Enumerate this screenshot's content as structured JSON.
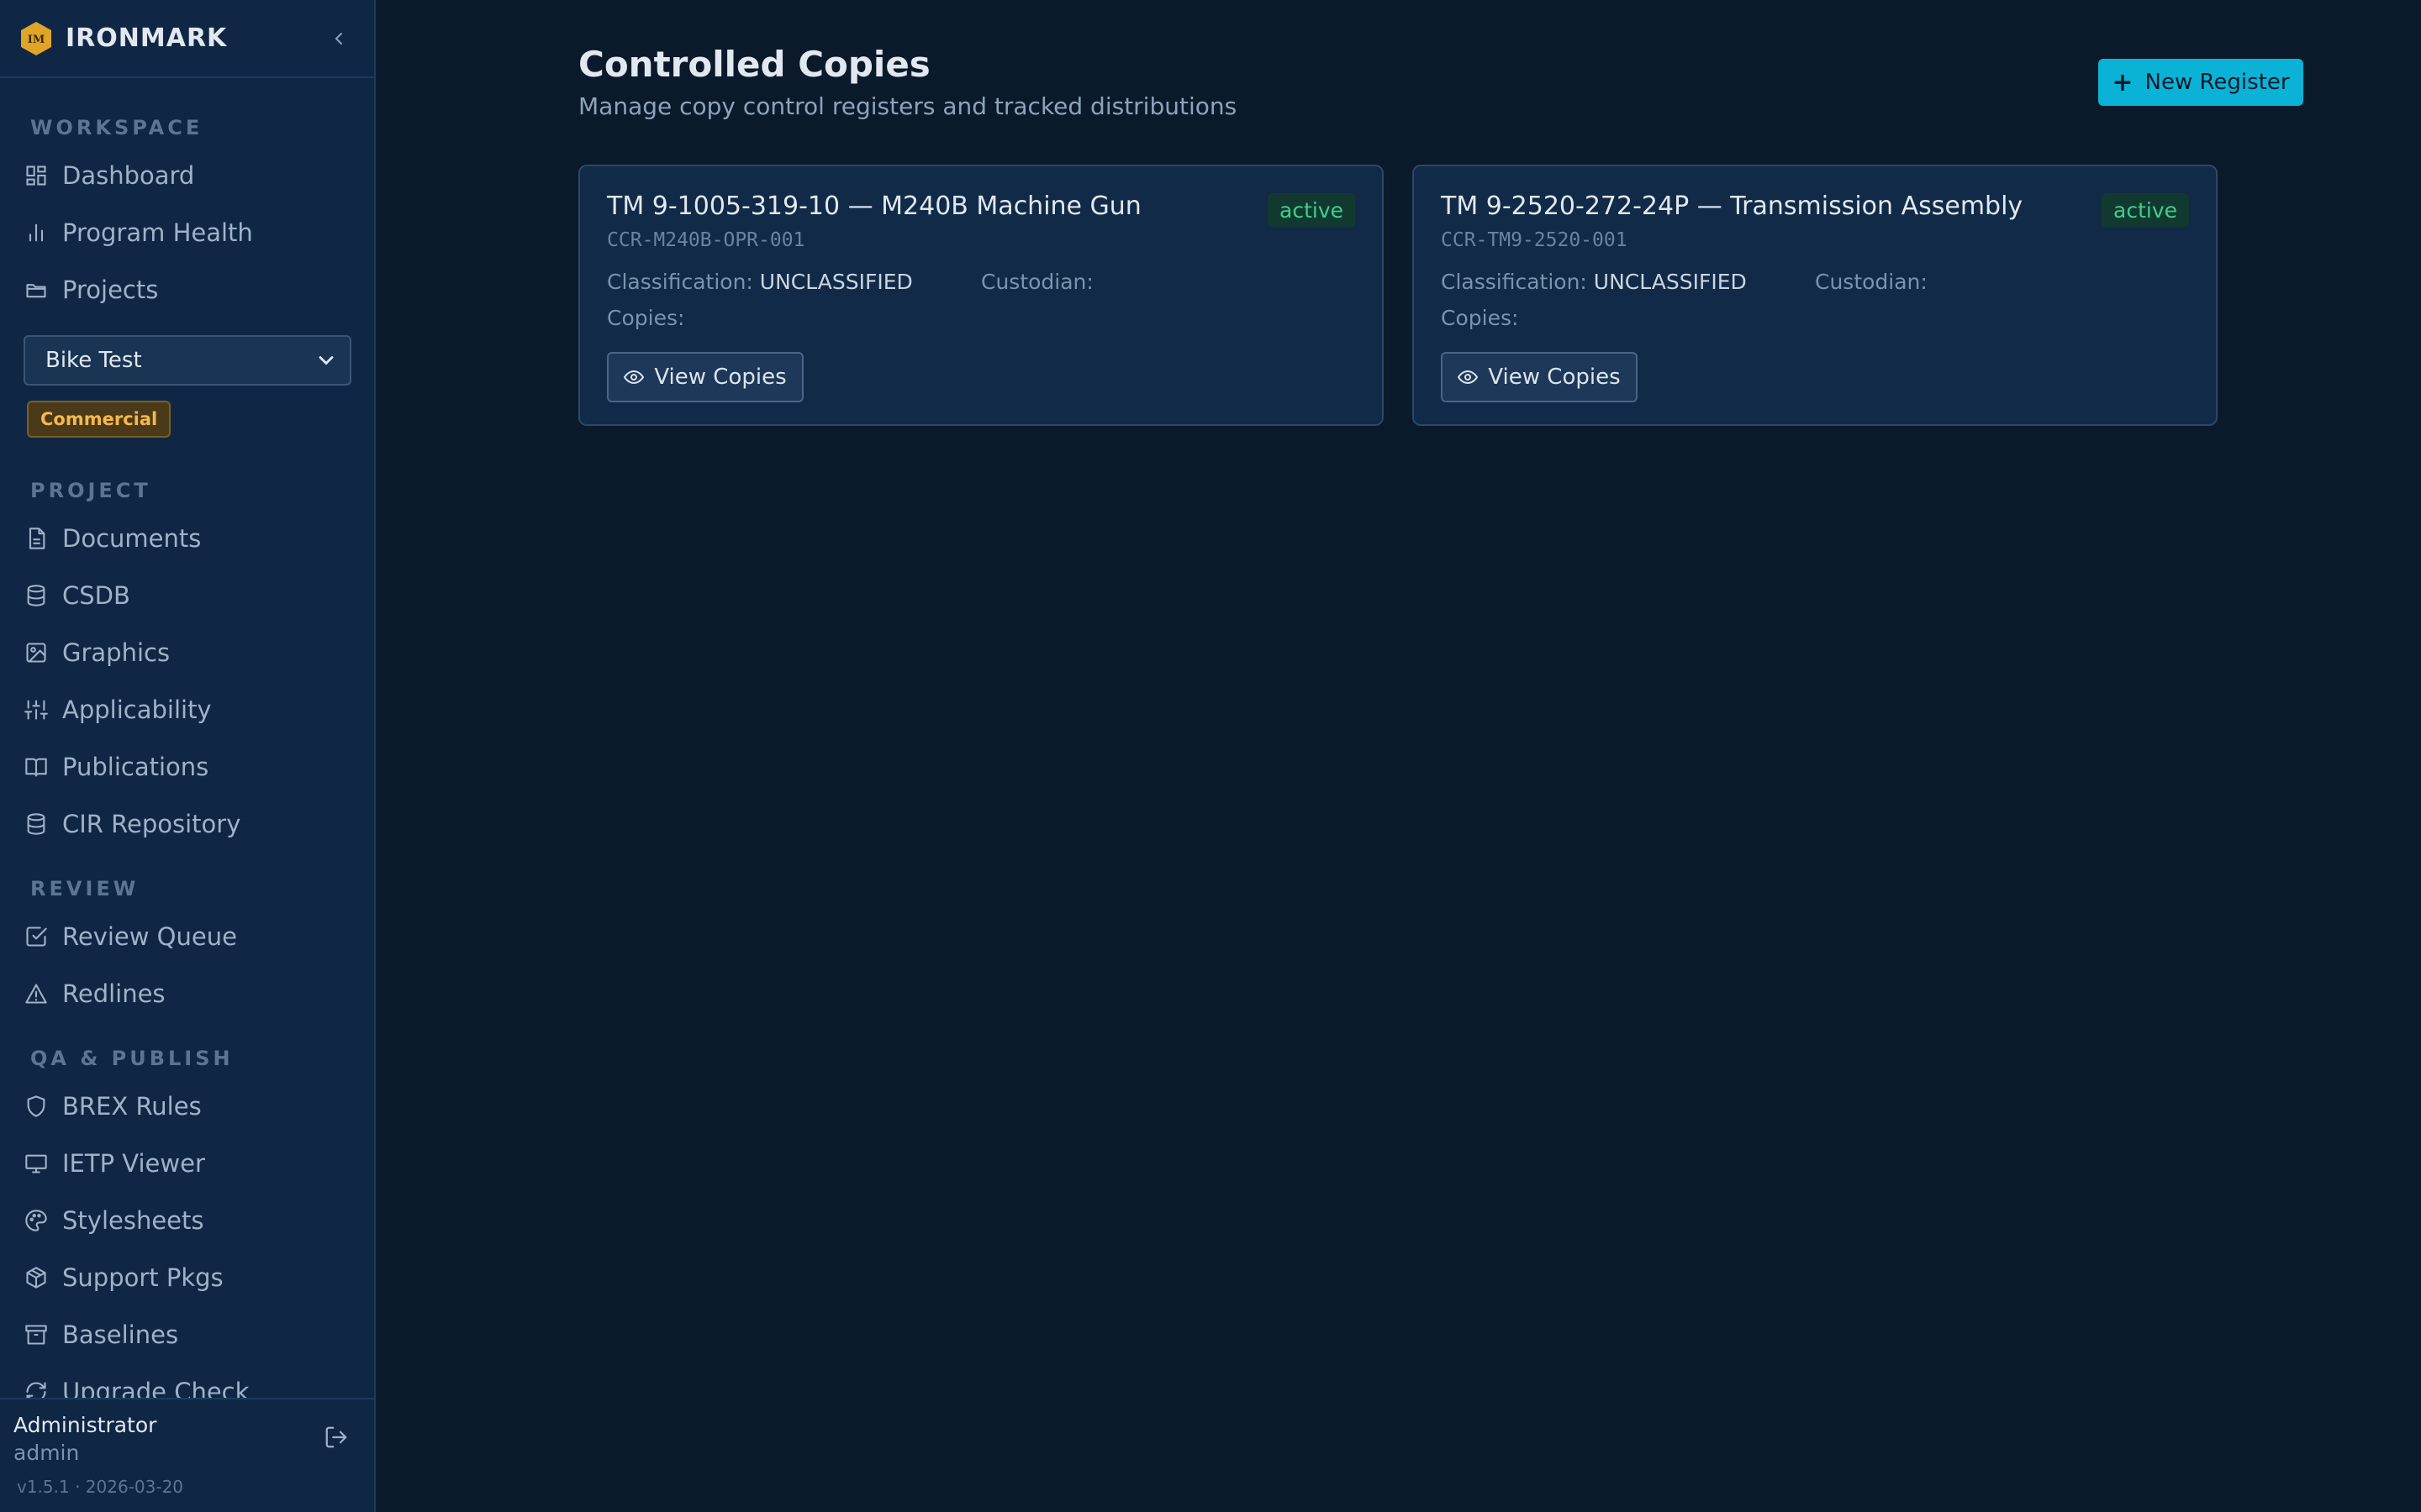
{
  "brand": {
    "name": "IRONMARK",
    "logo_text": "IM"
  },
  "sidebar": {
    "sections": {
      "workspace": "WORKSPACE",
      "project": "PROJECT",
      "review": "REVIEW",
      "qa": "QA & PUBLISH"
    },
    "workspace_items": [
      {
        "label": "Dashboard",
        "icon": "dashboard-icon"
      },
      {
        "label": "Program Health",
        "icon": "bar-chart-icon"
      },
      {
        "label": "Projects",
        "icon": "folder-icon"
      }
    ],
    "project_select": {
      "value": "Bike Test"
    },
    "project_badge": "Commercial",
    "project_items": [
      {
        "label": "Documents",
        "icon": "document-icon"
      },
      {
        "label": "CSDB",
        "icon": "database-icon"
      },
      {
        "label": "Graphics",
        "icon": "image-icon"
      },
      {
        "label": "Applicability",
        "icon": "sliders-icon"
      },
      {
        "label": "Publications",
        "icon": "book-icon"
      },
      {
        "label": "CIR Repository",
        "icon": "database-icon"
      }
    ],
    "review_items": [
      {
        "label": "Review Queue",
        "icon": "checkbox-icon"
      },
      {
        "label": "Redlines",
        "icon": "warning-icon"
      }
    ],
    "qa_items": [
      {
        "label": "BREX Rules",
        "icon": "shield-icon"
      },
      {
        "label": "IETP Viewer",
        "icon": "monitor-icon"
      },
      {
        "label": "Stylesheets",
        "icon": "palette-icon"
      },
      {
        "label": "Support Pkgs",
        "icon": "package-icon"
      },
      {
        "label": "Baselines",
        "icon": "archive-icon"
      },
      {
        "label": "Upgrade Check",
        "icon": "refresh-icon"
      }
    ],
    "footer": {
      "user_name": "Administrator",
      "user_role": "admin",
      "version": "v1.5.1 · 2026-03-20"
    }
  },
  "main": {
    "title": "Controlled Copies",
    "subtitle": "Manage copy control registers and tracked distributions",
    "new_button": "New Register",
    "labels": {
      "classification": "Classification:",
      "custodian": "Custodian:",
      "copies": "Copies:",
      "view_copies": "View Copies"
    },
    "registers": [
      {
        "title": "TM 9-1005-319-10 — M240B Machine Gun",
        "code": "CCR-M240B-OPR-001",
        "status": "active",
        "classification": "UNCLASSIFIED"
      },
      {
        "title": "TM 9-2520-272-24P — Transmission Assembly",
        "code": "CCR-TM9-2520-001",
        "status": "active",
        "classification": "UNCLASSIFIED"
      }
    ]
  },
  "colors": {
    "accent": "#0ab3d6",
    "active_status": "#3ecf8e",
    "commercial_badge": "#f5b94a",
    "logo": "#e0a526"
  }
}
